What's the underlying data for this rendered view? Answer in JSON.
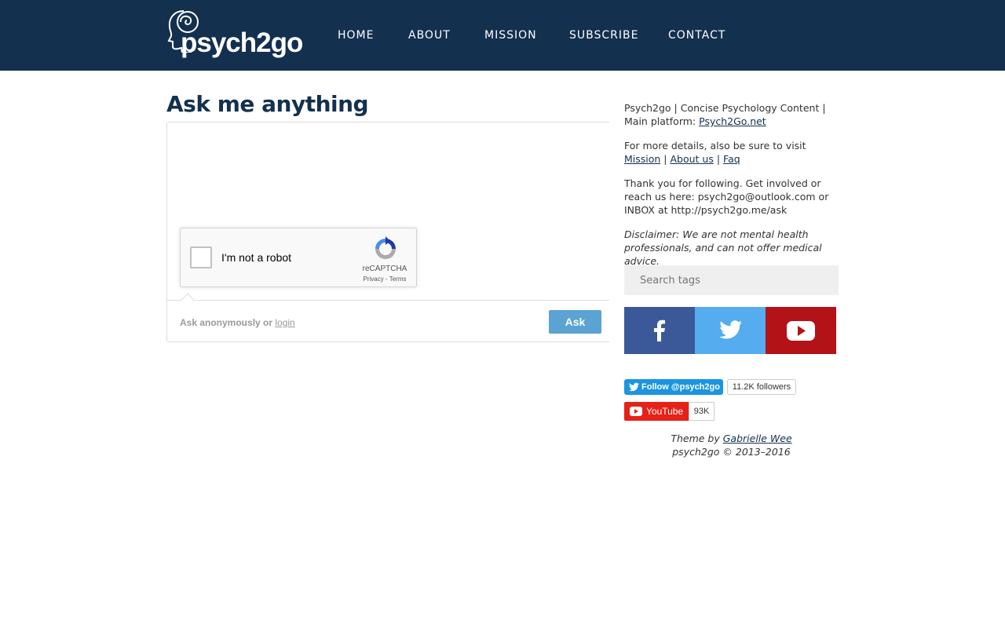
{
  "header": {
    "logo_text": "psych2go",
    "nav": [
      {
        "label": "HOME"
      },
      {
        "label": "ABOUT"
      },
      {
        "label": "MISSION"
      },
      {
        "label": "SUBSCRIBE"
      },
      {
        "label": "CONTACT"
      }
    ],
    "background_color": "#13304f"
  },
  "main": {
    "title": "Ask me anything",
    "recaptcha": {
      "label": "I'm not a robot",
      "brand": "reCAPTCHA",
      "privacy": "Privacy",
      "separator": " - ",
      "terms": "Terms"
    },
    "anon_text": "Ask anonymously or",
    "login_label": "login",
    "ask_button": "Ask"
  },
  "sidebar": {
    "intro_text": "Psych2go | Concise Psychology Content | Main platform: ",
    "intro_link": "Psych2Go.net",
    "details_text": "For more details, also be sure to visit ",
    "mission_link": "Mission",
    "sep1": " | ",
    "about_link": "About us",
    "sep2": " | ",
    "faq_link": "Faq",
    "thanks_text": "Thank you for following. Get involved or reach us here: psych2go@outlook.com or INBOX at http://psych2go.me/ask",
    "disclaimer": "Disclaimer: We are not mental health professionals, and can not offer medical advice.",
    "search_placeholder": "Search tags",
    "social": [
      {
        "icon": "facebook-icon",
        "color": "#3b5998"
      },
      {
        "icon": "twitter-icon",
        "color": "#55acee"
      },
      {
        "icon": "youtube-icon",
        "color": "#b31217"
      }
    ],
    "twitter_follow": "Follow @psych2go",
    "twitter_followers": "11.2K followers",
    "youtube_label": "YouTube",
    "youtube_count": "93K",
    "theme_by": "Theme by ",
    "theme_author": "Gabrielle Wee",
    "copyright": "psych2go © 2013–2016"
  }
}
